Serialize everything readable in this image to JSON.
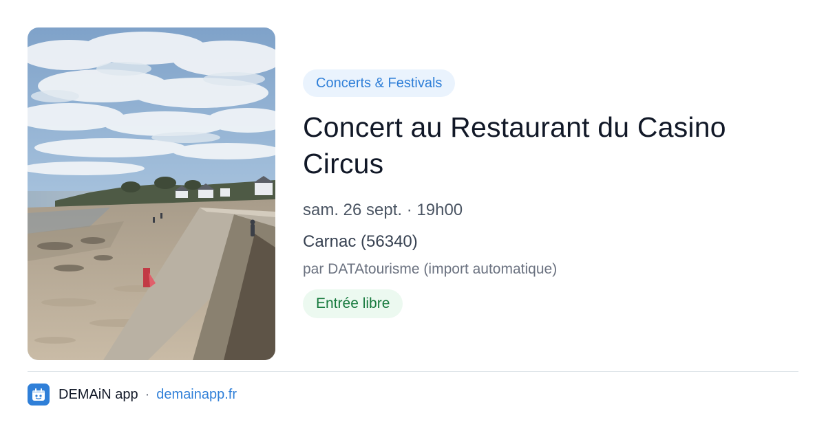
{
  "event": {
    "category": "Concerts & Festivals",
    "title": "Concert au Restaurant du Casino Circus",
    "date": "sam. 26 sept. · 19h00",
    "location": "Carnac (56340)",
    "source": "par DATAtourisme (import automatique)",
    "price": "Entrée libre",
    "image": "beach-promenade-photo"
  },
  "footer": {
    "logo_icon": "demain-logo-icon",
    "app_name": "DEMAiN app",
    "separator": "·",
    "url": "demainapp.fr"
  },
  "colors": {
    "accent": "#2f7fd8",
    "category_chip_bg": "#eaf3fd",
    "price_chip_bg": "#ecf9f0",
    "price_chip_text": "#177a3e",
    "title": "#111827"
  }
}
